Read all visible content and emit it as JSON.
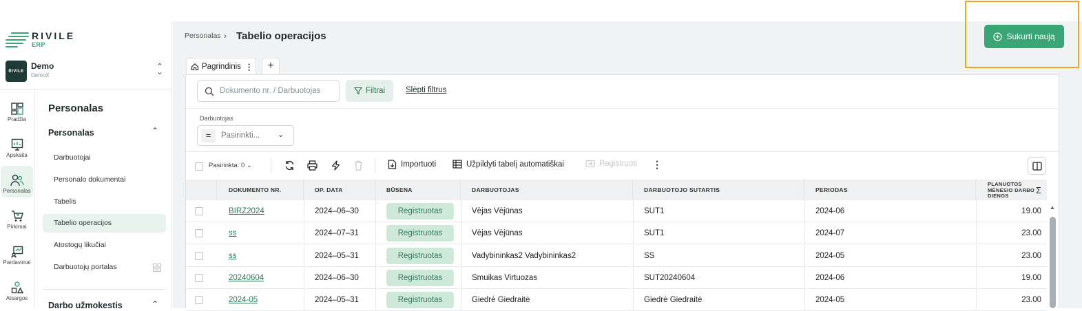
{
  "app": {
    "brand": "RIVILE",
    "brand_sub": "ERP"
  },
  "company": {
    "name": "Demo",
    "sub": "DemoX",
    "avatar_text": "RIVILE"
  },
  "rail": [
    {
      "label": "Pradžia",
      "icon": "dashboard-icon"
    },
    {
      "label": "Apskaita",
      "icon": "chart-icon"
    },
    {
      "label": "Personalas",
      "icon": "users-icon",
      "active": true
    },
    {
      "label": "Pirkimai",
      "icon": "cart-icon"
    },
    {
      "label": "Pardavimai",
      "icon": "sales-icon"
    },
    {
      "label": "Atsargos",
      "icon": "shapes-icon"
    }
  ],
  "nav": {
    "title": "Personalas",
    "group": "Personalas",
    "items": [
      {
        "label": "Darbuotojai"
      },
      {
        "label": "Personalo dokumentai"
      },
      {
        "label": "Tabelis"
      },
      {
        "label": "Tabelio operacijos",
        "active": true
      },
      {
        "label": "Atostogų likučiai"
      },
      {
        "label": "Darbuotojų portalas"
      }
    ],
    "group2": "Darbo užmokestis"
  },
  "breadcrumb": {
    "parent": "Personalas",
    "separator": "›",
    "current": "Tabelio operacijos"
  },
  "create_button": {
    "label": "Sukurti naują"
  },
  "tabs": [
    {
      "label": "Pagrindinis"
    }
  ],
  "search": {
    "placeholder": "Dokumento nr. / Darbuotojas"
  },
  "filter_button": {
    "label": "Filtrai"
  },
  "hide_filters": {
    "label": "Slėpti filtrus"
  },
  "employee_filter": {
    "label": "Darbuotojas",
    "placeholder": "Pasirinkti..."
  },
  "toolbar": {
    "selected": "Pasirinkta: 0",
    "import": "Importuoti",
    "autofill": "Užpildyti tabelį automatiškai",
    "register": "Registruoti"
  },
  "table": {
    "columns": [
      "DOKUMENTO NR.",
      "OP. DATA",
      "BŪSENA",
      "DARBUOTOJAS",
      "DARBUOTOJO SUTARTIS",
      "PERIODAS",
      "PLANUOTOS MĖNESIO DARBO DIENOS"
    ],
    "sum_symbol": "Σ",
    "rows": [
      {
        "doc": "BIRZ2024",
        "date": "2024–06–30",
        "status": "Registruotas",
        "employee": "Vėjas Vėjūnas",
        "contract": "SUT1",
        "period": "2024-06",
        "days": "19.00"
      },
      {
        "doc": "ss",
        "date": "2024–07–31",
        "status": "Registruotas",
        "employee": "Vėjas Vėjūnas",
        "contract": "SUT1",
        "period": "2024-07",
        "days": "23.00"
      },
      {
        "doc": "ss",
        "date": "2024–05–31",
        "status": "Registruotas",
        "employee": "Vadybininkas2 Vadybininkas2",
        "contract": "SS",
        "period": "2024-05",
        "days": "23.00"
      },
      {
        "doc": "20240604",
        "date": "2024–06–30",
        "status": "Registruotas",
        "employee": "Smuikas Virtuozas",
        "contract": "SUT20240604",
        "period": "2024-06",
        "days": "19.00"
      },
      {
        "doc": "2024-05",
        "date": "2024–05–31",
        "status": "Registruotas",
        "employee": "Giedrė Giedraitė",
        "contract": "Giedrė Giedraitė",
        "period": "2024-05",
        "days": "23.00"
      }
    ]
  },
  "colors": {
    "accent": "#3aa676",
    "badge_bg": "#cfe9d9",
    "badge_text": "#2d7a57",
    "highlight": "#f0a51c"
  }
}
